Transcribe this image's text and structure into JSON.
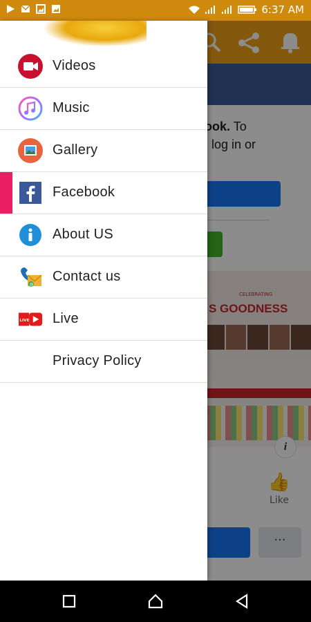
{
  "status_bar": {
    "time": "6:37 AM",
    "background_color": "#d08a0e"
  },
  "background_page": {
    "text_line1_bold": "ook.",
    "text_line1_rest": " To",
    "text_line2": ", log in or",
    "banner_celebrating": "CELEBRATING",
    "banner_title": "S GOODNESS",
    "info_glyph": "i",
    "like_label": "Like",
    "more_glyph": "···"
  },
  "drawer": {
    "items": [
      {
        "label": "Videos",
        "icon": "video-camera-icon"
      },
      {
        "label": "Music",
        "icon": "music-note-icon"
      },
      {
        "label": "Gallery",
        "icon": "picture-icon"
      },
      {
        "label": "Facebook",
        "icon": "facebook-icon",
        "active": true
      },
      {
        "label": "About US",
        "icon": "info-icon"
      },
      {
        "label": "Contact us",
        "icon": "contact-icon"
      },
      {
        "label": "Live",
        "icon": "live-icon"
      },
      {
        "label": "Privacy Policy",
        "icon": ""
      }
    ],
    "active_color": "#e91e63"
  },
  "nav_bar": {
    "recent": "square-icon",
    "home": "home-icon",
    "back": "back-triangle-icon"
  }
}
